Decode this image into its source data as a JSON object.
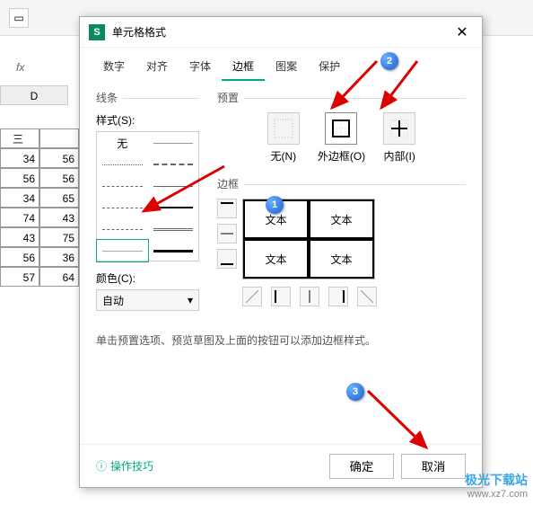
{
  "toolbar": {
    "fx": "fx"
  },
  "columns": [
    "D"
  ],
  "grid": {
    "header": "三",
    "rows": [
      [
        34,
        56
      ],
      [
        56,
        56
      ],
      [
        34,
        65
      ],
      [
        74,
        43
      ],
      [
        43,
        75
      ],
      [
        56,
        36
      ],
      [
        57,
        64
      ]
    ]
  },
  "dialog": {
    "title": "单元格格式",
    "tabs": [
      "数字",
      "对齐",
      "字体",
      "边框",
      "图案",
      "保护"
    ],
    "active_tab": 3,
    "line_section": "线条",
    "style_label": "样式(S):",
    "none_text": "无",
    "color_label": "颜色(C):",
    "color_value": "自动",
    "preset_section": "预置",
    "presets": [
      {
        "label": "无(N)"
      },
      {
        "label": "外边框(O)"
      },
      {
        "label": "内部(I)"
      }
    ],
    "border_section": "边框",
    "preview_text": "文本",
    "hint": "单击预置选项、预览草图及上面的按钮可以添加边框样式。",
    "tips": "操作技巧",
    "ok": "确定",
    "cancel": "取消"
  },
  "bubbles": {
    "b1": "1",
    "b2": "2",
    "b3": "3"
  },
  "watermark": {
    "line1": "极光下载站",
    "line2": "www.xz7.com"
  }
}
